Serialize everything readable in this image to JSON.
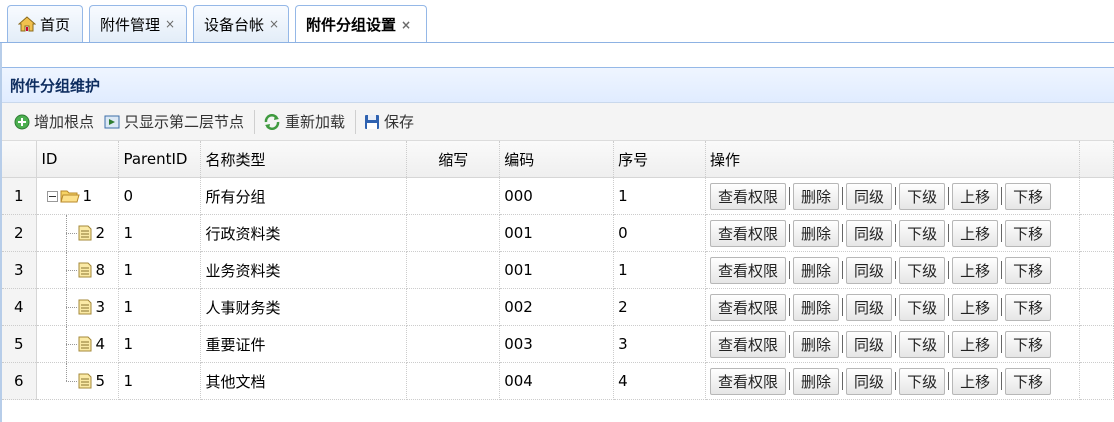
{
  "tabs": [
    {
      "label": "首页",
      "icon": "home-icon",
      "closable": false,
      "active": false
    },
    {
      "label": "附件管理",
      "closable": true,
      "active": false
    },
    {
      "label": "设备台帐",
      "closable": true,
      "active": false
    },
    {
      "label": "附件分组设置",
      "closable": true,
      "active": true
    }
  ],
  "tab_close_glyph": "×",
  "panel": {
    "title": "附件分组维护"
  },
  "toolbar": {
    "add_root": "增加根点",
    "show_second_level": "只显示第二层节点",
    "reload": "重新加载",
    "save": "保存"
  },
  "grid": {
    "columns": [
      "ID",
      "ParentID",
      "名称类型",
      "缩写",
      "编码",
      "序号",
      "操作"
    ],
    "rows": [
      {
        "rownum": "1",
        "id": "1",
        "parent": "0",
        "name": "所有分组",
        "abbr": "",
        "code": "000",
        "order": "1",
        "level": 0,
        "expanded": true
      },
      {
        "rownum": "2",
        "id": "2",
        "parent": "1",
        "name": "行政资料类",
        "abbr": "",
        "code": "001",
        "order": "0",
        "level": 1
      },
      {
        "rownum": "3",
        "id": "8",
        "parent": "1",
        "name": "业务资料类",
        "abbr": "",
        "code": "001",
        "order": "1",
        "level": 1
      },
      {
        "rownum": "4",
        "id": "3",
        "parent": "1",
        "name": "人事财务类",
        "abbr": "",
        "code": "002",
        "order": "2",
        "level": 1
      },
      {
        "rownum": "5",
        "id": "4",
        "parent": "1",
        "name": "重要证件",
        "abbr": "",
        "code": "003",
        "order": "3",
        "level": 1
      },
      {
        "rownum": "6",
        "id": "5",
        "parent": "1",
        "name": "其他文档",
        "abbr": "",
        "code": "004",
        "order": "4",
        "level": 1,
        "last": true
      }
    ],
    "row_actions": [
      "查看权限",
      "删除",
      "同级",
      "下级",
      "上移",
      "下移"
    ]
  },
  "colors": {
    "accent": "#95b8e7",
    "header_bg": "#e0ecff",
    "title_text": "#0e2d5f"
  }
}
